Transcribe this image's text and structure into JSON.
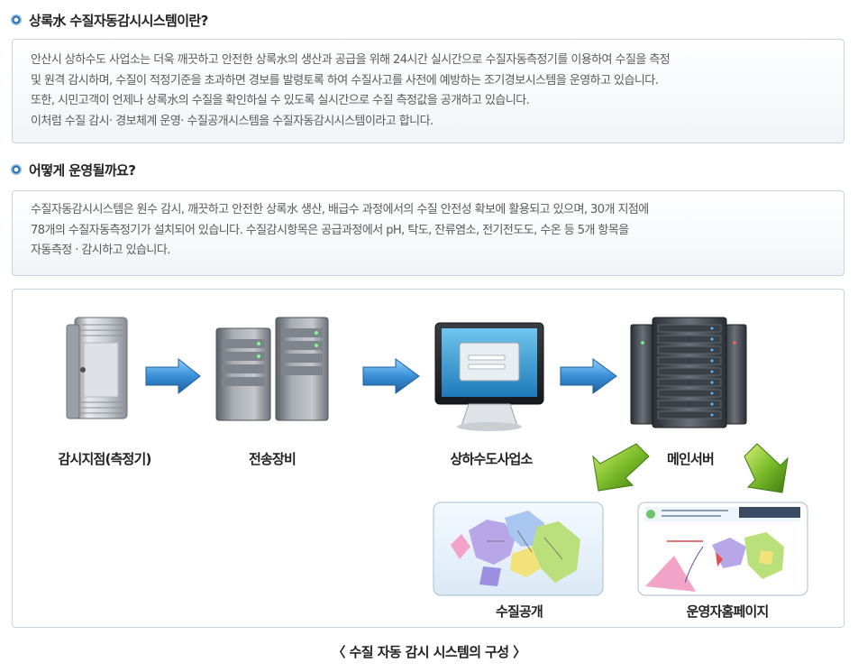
{
  "section1": {
    "heading": "상록水 수질자동감시시스템이란?",
    "lines": [
      "안산시 상하수도 사업소는 더욱 깨끗하고 안전한 상록水의 생산과 공급을 위해 24시간 실시간으로 수질자동측정기를 이용하여 수질을 측정",
      "및 원격 감시하며, 수질이 적정기준을 초과하면 경보를 발령토록 하여 수질사고를 사전에 예방하는 조기경보시스템을 운영하고 있습니다.",
      "또한, 시민고객이 언제나 상록水의 수질을 확인하실 수 있도록 실시간으로 수질 측정값을 공개하고 있습니다.",
      "이처럼 수질 감시· 경보체계 운영· 수질공개시스템을 수질자동감시시스템이라고 합니다."
    ]
  },
  "section2": {
    "heading": "어떻게 운영될까요?",
    "lines": [
      "수질자동감시시스템은 원수 감시, 깨끗하고 안전한 상록水 생산, 배급수 과정에서의 수질 안전성 확보에 활용되고 있으며, 30개 지점에",
      "78개의 수질자동측정기가 설치되어 있습니다. 수질감시항목은 공급과정에서 pH, 탁도, 잔류염소, 전기전도도, 수온 등 5개 항목을",
      "자동측정 · 감시하고 있습니다."
    ]
  },
  "diagram": {
    "nodes": {
      "monitor_point": "감시지점(측정기)",
      "transmission": "전송장비",
      "office": "상하수도사업소",
      "main_server": "메인서버",
      "public": "수질공개",
      "admin_page": "운영자홈페이지"
    },
    "caption": "〈 수질 자동 감시 시스템의 구성 〉"
  },
  "colors": {
    "bullet_blue": "#2e6fa8",
    "arrow_blue": "#3a8fd6",
    "arrow_green": "#5a9e1e",
    "box_border": "#c9d3dd"
  }
}
